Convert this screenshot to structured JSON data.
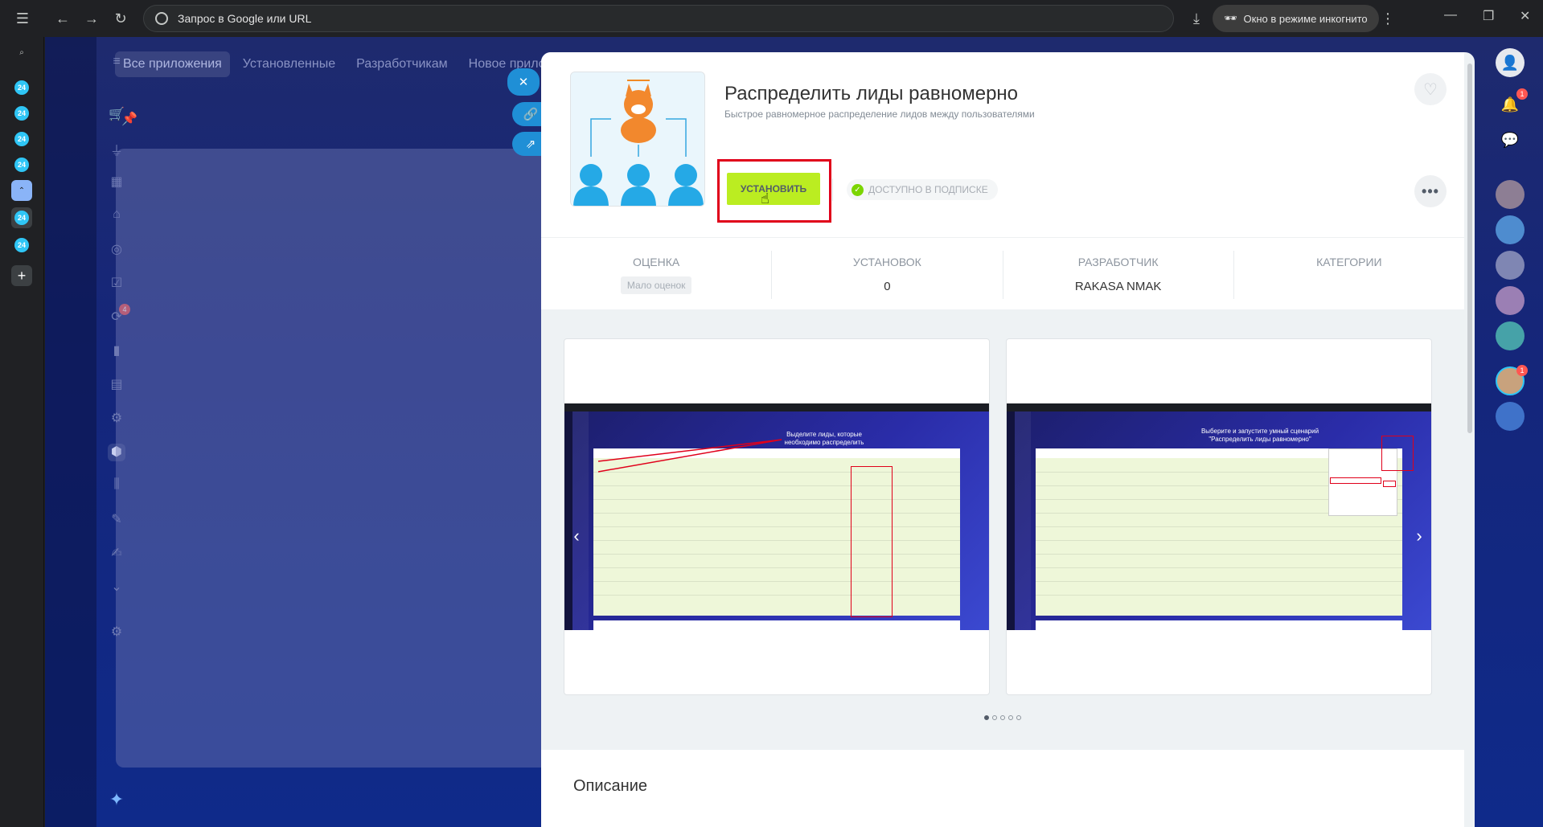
{
  "browser": {
    "address": "Запрос в Google или URL",
    "incognito": "Окно в режиме инкогнито"
  },
  "tabs_strip": {
    "b24_label": "24"
  },
  "b24": {
    "tabs": [
      "Все приложения",
      "Установленные",
      "Разработчикам",
      "Новое приложение"
    ],
    "nav_badge": "4"
  },
  "app": {
    "title": "Распределить лиды равномерно",
    "subtitle": "Быстрое равномерное распределение лидов между пользователями",
    "install_label": "УСТАНОВИТЬ",
    "subscription_label": "ДОСТУПНО В ПОДПИСКЕ",
    "more_label": "•••"
  },
  "stats": {
    "rating_label": "ОЦЕНКА",
    "rating_value": "Мало оценок",
    "installs_label": "УСТАНОВОК",
    "installs_value": "0",
    "developer_label": "РАЗРАБОТЧИК",
    "developer_value": "RAKASA NMAK",
    "categories_label": "КАТЕГОРИИ"
  },
  "gallery": {
    "shot1_caption": "Выделите лиды, которые необходимо распределить",
    "shot2_caption": "Выберите и запустите умный сценарий \"Распределить лиды равномерно\"",
    "dots_total": 5,
    "active_dot": 1
  },
  "description": {
    "heading": "Описание"
  },
  "right_rail": {
    "notif_badge": "1",
    "avatar_badge": "1"
  }
}
